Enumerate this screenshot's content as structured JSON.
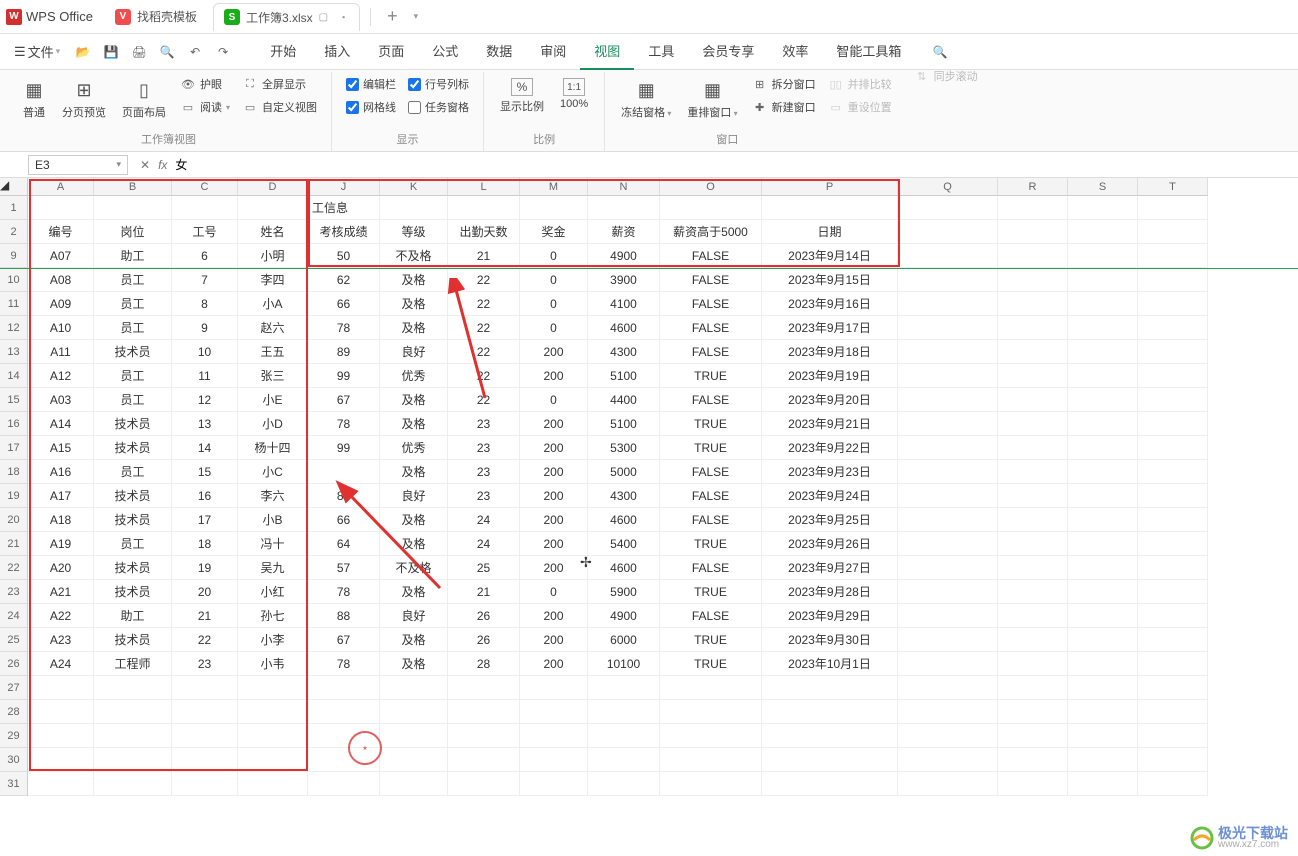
{
  "titlebar": {
    "app": "WPS Office",
    "tabs": [
      {
        "icon": "V",
        "label": "找稻壳模板"
      },
      {
        "icon": "S",
        "label": "工作簿3.xlsx",
        "active": true
      }
    ]
  },
  "menu": {
    "file": "文件",
    "items": [
      "开始",
      "插入",
      "页面",
      "公式",
      "数据",
      "审阅",
      "视图",
      "工具",
      "会员专享",
      "效率",
      "智能工具箱"
    ],
    "activeIndex": 6
  },
  "ribbon": {
    "group1": {
      "label": "工作簿视图",
      "normal": "普通",
      "pagebreak": "分页预览",
      "pagelayout": "页面布局",
      "eye": "护眼",
      "read": "阅读",
      "full": "全屏显示",
      "custom": "自定义视图"
    },
    "group2": {
      "label": "显示",
      "editbar": "编辑栏",
      "rowcol": "行号列标",
      "gridlines": "网格线",
      "taskpane": "任务窗格"
    },
    "group3": {
      "label": "比例",
      "zoom": "显示比例",
      "hundred": "100%"
    },
    "group4": {
      "label": "窗口",
      "freeze": "冻结窗格",
      "arrange": "重排窗口",
      "split": "拆分窗口",
      "new": "新建窗口",
      "sidebyside": "并排比较",
      "syncscroll": "同步滚动",
      "resetpos": "重设位置"
    }
  },
  "formula": {
    "namebox": "E3",
    "value": "女"
  },
  "cols": [
    "A",
    "B",
    "C",
    "D",
    "J",
    "K",
    "L",
    "M",
    "N",
    "O",
    "P",
    "Q",
    "R",
    "S",
    "T"
  ],
  "rowNums": [
    "1",
    "2",
    "9",
    "10",
    "11",
    "12",
    "13",
    "14",
    "15",
    "16",
    "17",
    "18",
    "19",
    "20",
    "21",
    "22",
    "23",
    "24",
    "25",
    "26",
    "27",
    "28",
    "29",
    "30",
    "31"
  ],
  "titleRow": {
    "info": "工信息"
  },
  "headers": {
    "A": "编号",
    "B": "岗位",
    "C": "工号",
    "D": "姓名",
    "J": "考核成绩",
    "K": "等级",
    "L": "出勤天数",
    "M": "奖金",
    "N": "薪资",
    "O": "薪资高于5000",
    "P": "日期"
  },
  "data": [
    {
      "A": "A07",
      "B": "助工",
      "C": "6",
      "D": "小明",
      "J": "50",
      "K": "不及格",
      "L": "21",
      "M": "0",
      "N": "4900",
      "O": "FALSE",
      "P": "2023年9月14日"
    },
    {
      "A": "A08",
      "B": "员工",
      "C": "7",
      "D": "李四",
      "J": "62",
      "K": "及格",
      "L": "22",
      "M": "0",
      "N": "3900",
      "O": "FALSE",
      "P": "2023年9月15日"
    },
    {
      "A": "A09",
      "B": "员工",
      "C": "8",
      "D": "小A",
      "J": "66",
      "K": "及格",
      "L": "22",
      "M": "0",
      "N": "4100",
      "O": "FALSE",
      "P": "2023年9月16日"
    },
    {
      "A": "A10",
      "B": "员工",
      "C": "9",
      "D": "赵六",
      "J": "78",
      "K": "及格",
      "L": "22",
      "M": "0",
      "N": "4600",
      "O": "FALSE",
      "P": "2023年9月17日"
    },
    {
      "A": "A11",
      "B": "技术员",
      "C": "10",
      "D": "王五",
      "J": "89",
      "K": "良好",
      "L": "22",
      "M": "200",
      "N": "4300",
      "O": "FALSE",
      "P": "2023年9月18日"
    },
    {
      "A": "A12",
      "B": "员工",
      "C": "11",
      "D": "张三",
      "J": "99",
      "K": "优秀",
      "L": "22",
      "M": "200",
      "N": "5100",
      "O": "TRUE",
      "P": "2023年9月19日"
    },
    {
      "A": "A03",
      "B": "员工",
      "C": "12",
      "D": "小E",
      "J": "67",
      "K": "及格",
      "L": "22",
      "M": "0",
      "N": "4400",
      "O": "FALSE",
      "P": "2023年9月20日"
    },
    {
      "A": "A14",
      "B": "技术员",
      "C": "13",
      "D": "小D",
      "J": "78",
      "K": "及格",
      "L": "23",
      "M": "200",
      "N": "5100",
      "O": "TRUE",
      "P": "2023年9月21日"
    },
    {
      "A": "A15",
      "B": "技术员",
      "C": "14",
      "D": "杨十四",
      "J": "99",
      "K": "优秀",
      "L": "23",
      "M": "200",
      "N": "5300",
      "O": "TRUE",
      "P": "2023年9月22日"
    },
    {
      "A": "A16",
      "B": "员工",
      "C": "15",
      "D": "小C",
      "J": "",
      "K": "及格",
      "L": "23",
      "M": "200",
      "N": "5000",
      "O": "FALSE",
      "P": "2023年9月23日"
    },
    {
      "A": "A17",
      "B": "技术员",
      "C": "16",
      "D": "李六",
      "J": "85",
      "K": "良好",
      "L": "23",
      "M": "200",
      "N": "4300",
      "O": "FALSE",
      "P": "2023年9月24日"
    },
    {
      "A": "A18",
      "B": "技术员",
      "C": "17",
      "D": "小B",
      "J": "66",
      "K": "及格",
      "L": "24",
      "M": "200",
      "N": "4600",
      "O": "FALSE",
      "P": "2023年9月25日"
    },
    {
      "A": "A19",
      "B": "员工",
      "C": "18",
      "D": "冯十",
      "J": "64",
      "K": "及格",
      "L": "24",
      "M": "200",
      "N": "5400",
      "O": "TRUE",
      "P": "2023年9月26日"
    },
    {
      "A": "A20",
      "B": "技术员",
      "C": "19",
      "D": "吴九",
      "J": "57",
      "K": "不及格",
      "L": "25",
      "M": "200",
      "N": "4600",
      "O": "FALSE",
      "P": "2023年9月27日"
    },
    {
      "A": "A21",
      "B": "技术员",
      "C": "20",
      "D": "小红",
      "J": "78",
      "K": "及格",
      "L": "21",
      "M": "0",
      "N": "5900",
      "O": "TRUE",
      "P": "2023年9月28日"
    },
    {
      "A": "A22",
      "B": "助工",
      "C": "21",
      "D": "孙七",
      "J": "88",
      "K": "良好",
      "L": "26",
      "M": "200",
      "N": "4900",
      "O": "FALSE",
      "P": "2023年9月29日"
    },
    {
      "A": "A23",
      "B": "技术员",
      "C": "22",
      "D": "小李",
      "J": "67",
      "K": "及格",
      "L": "26",
      "M": "200",
      "N": "6000",
      "O": "TRUE",
      "P": "2023年9月30日"
    },
    {
      "A": "A24",
      "B": "工程师",
      "C": "23",
      "D": "小韦",
      "J": "78",
      "K": "及格",
      "L": "28",
      "M": "200",
      "N": "10100",
      "O": "TRUE",
      "P": "2023年10月1日"
    }
  ],
  "watermark": {
    "name": "极光下载站",
    "url": "www.xz7.com"
  }
}
